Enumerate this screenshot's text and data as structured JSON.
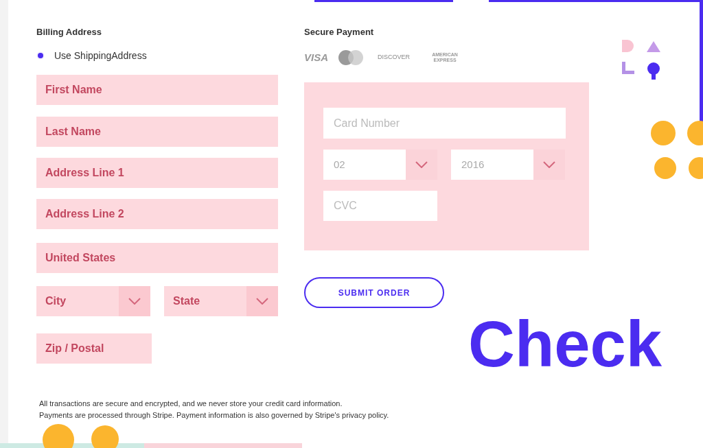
{
  "billing": {
    "title": "Billing Address",
    "radio": {
      "label": "Use ShippingAddress",
      "selected": true
    },
    "fields": [
      {
        "kind": "text",
        "placeholder": "First Name"
      },
      {
        "kind": "text",
        "placeholder": "Last Name"
      },
      {
        "kind": "text",
        "placeholder": "Address Line 1"
      },
      {
        "kind": "text",
        "placeholder": "Address Line 2"
      },
      {
        "kind": "text",
        "placeholder": "United States"
      },
      {
        "kind": "selects",
        "items": [
          {
            "placeholder": "City"
          },
          {
            "placeholder": "State"
          }
        ]
      },
      {
        "kind": "short",
        "placeholder": "Zip / Postal"
      }
    ]
  },
  "payment": {
    "title": "Secure Payment",
    "cards": [
      {
        "kind": "visa",
        "label": "VISA"
      },
      {
        "kind": "mastercard"
      },
      {
        "kind": "discover",
        "label": "DISCOVER"
      },
      {
        "kind": "amex",
        "label": "AMERICAN EXPRESS"
      }
    ],
    "card_number": {
      "placeholder": "Card Number"
    },
    "month": {
      "value": "02"
    },
    "year": {
      "value": "2016"
    },
    "cvc": {
      "placeholder": "CVC"
    },
    "submit": "SUBMIT ORDER"
  },
  "heading": "Check",
  "notice": [
    "All transactions are secure and encrypted, and we never store your credit card information.",
    "Payments are processed through Stripe. Payment information is also governed by Stripe's privacy policy."
  ]
}
